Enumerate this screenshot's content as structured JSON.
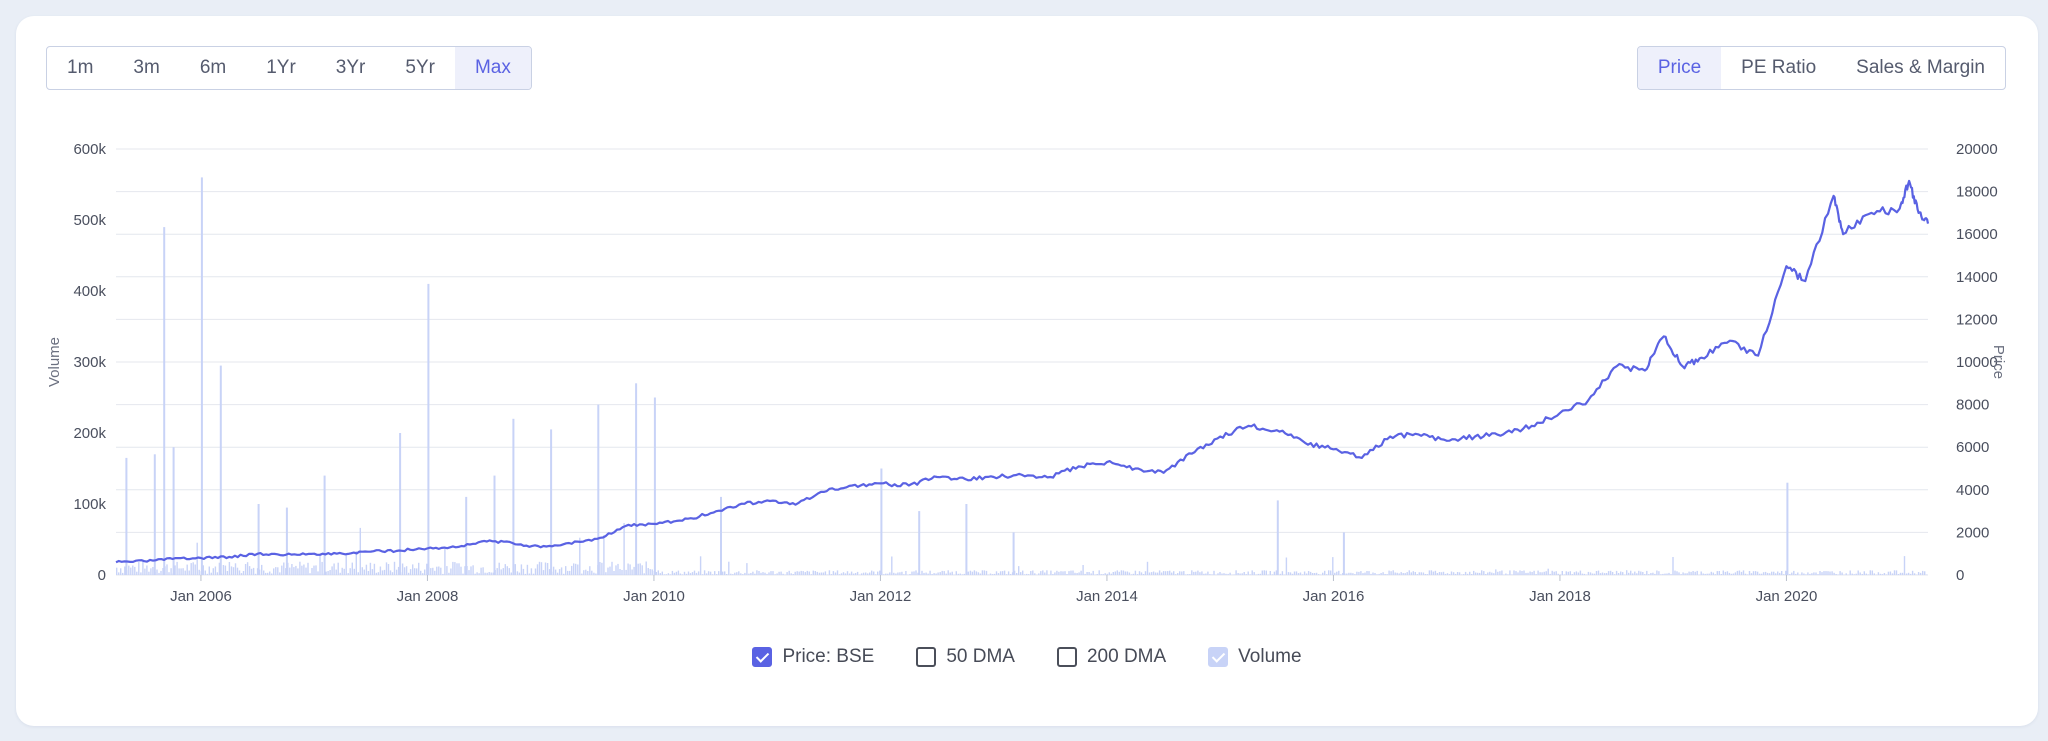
{
  "range_buttons": [
    {
      "label": "1m",
      "active": false
    },
    {
      "label": "3m",
      "active": false
    },
    {
      "label": "6m",
      "active": false
    },
    {
      "label": "1Yr",
      "active": false
    },
    {
      "label": "3Yr",
      "active": false
    },
    {
      "label": "5Yr",
      "active": false
    },
    {
      "label": "Max",
      "active": true
    }
  ],
  "metric_buttons": [
    {
      "label": "Price",
      "active": true
    },
    {
      "label": "PE Ratio",
      "active": false
    },
    {
      "label": "Sales & Margin",
      "active": false
    }
  ],
  "legend": [
    {
      "label": "Price: BSE",
      "checked": true,
      "style": "checked"
    },
    {
      "label": "50 DMA",
      "checked": false,
      "style": "unchecked"
    },
    {
      "label": "200 DMA",
      "checked": false,
      "style": "unchecked"
    },
    {
      "label": "Volume",
      "checked": true,
      "style": "light"
    }
  ],
  "colors": {
    "price_line": "#5a62e3",
    "volume_bars": "#c8d3f7",
    "active_accent": "#5a62e3",
    "grid": "#e4e7ee"
  },
  "chart_data": {
    "type": "line",
    "x_range": [
      "2005-04",
      "2021-04"
    ],
    "x_ticks": [
      "Jan 2006",
      "Jan 2008",
      "Jan 2010",
      "Jan 2012",
      "Jan 2014",
      "Jan 2016",
      "Jan 2018",
      "Jan 2020"
    ],
    "y_left": {
      "label": "Volume",
      "min": 0,
      "max": 600000,
      "ticks": [
        "0",
        "100k",
        "200k",
        "300k",
        "400k",
        "500k",
        "600k"
      ]
    },
    "y_right": {
      "label": "Price",
      "min": 0,
      "max": 20000,
      "ticks": [
        "0",
        "2000",
        "4000",
        "6000",
        "8000",
        "10000",
        "12000",
        "14000",
        "16000",
        "18000",
        "20000"
      ]
    },
    "grid": true,
    "series": [
      {
        "name": "Price: BSE",
        "axis": "right",
        "points": [
          [
            "2005-04",
            600
          ],
          [
            "2005-07",
            650
          ],
          [
            "2005-10",
            750
          ],
          [
            "2006-01",
            800
          ],
          [
            "2006-04",
            850
          ],
          [
            "2006-07",
            1000
          ],
          [
            "2006-10",
            950
          ],
          [
            "2007-01",
            1000
          ],
          [
            "2007-04",
            1000
          ],
          [
            "2007-07",
            1100
          ],
          [
            "2007-10",
            1150
          ],
          [
            "2008-01",
            1250
          ],
          [
            "2008-04",
            1300
          ],
          [
            "2008-07",
            1600
          ],
          [
            "2008-10",
            1500
          ],
          [
            "2009-01",
            1300
          ],
          [
            "2009-04",
            1500
          ],
          [
            "2009-07",
            1700
          ],
          [
            "2009-10",
            2300
          ],
          [
            "2010-01",
            2400
          ],
          [
            "2010-04",
            2550
          ],
          [
            "2010-07",
            2900
          ],
          [
            "2010-10",
            3300
          ],
          [
            "2011-01",
            3500
          ],
          [
            "2011-04",
            3300
          ],
          [
            "2011-07",
            3900
          ],
          [
            "2011-10",
            4200
          ],
          [
            "2012-01",
            4300
          ],
          [
            "2012-04",
            4200
          ],
          [
            "2012-07",
            4600
          ],
          [
            "2012-10",
            4500
          ],
          [
            "2013-01",
            4600
          ],
          [
            "2013-04",
            4700
          ],
          [
            "2013-07",
            4600
          ],
          [
            "2013-10",
            5100
          ],
          [
            "2014-01",
            5300
          ],
          [
            "2014-04",
            5000
          ],
          [
            "2014-07",
            4800
          ],
          [
            "2014-10",
            5700
          ],
          [
            "2015-01",
            6500
          ],
          [
            "2015-04",
            7000
          ],
          [
            "2015-07",
            6800
          ],
          [
            "2015-10",
            6200
          ],
          [
            "2016-01",
            5900
          ],
          [
            "2016-04",
            5500
          ],
          [
            "2016-07",
            6500
          ],
          [
            "2016-10",
            6600
          ],
          [
            "2017-01",
            6300
          ],
          [
            "2017-04",
            6500
          ],
          [
            "2017-07",
            6600
          ],
          [
            "2017-10",
            7000
          ],
          [
            "2018-01",
            7600
          ],
          [
            "2018-04",
            8200
          ],
          [
            "2018-07",
            9800
          ],
          [
            "2018-10",
            9600
          ],
          [
            "2018-12",
            11200
          ],
          [
            "2019-02",
            9800
          ],
          [
            "2019-04",
            10200
          ],
          [
            "2019-07",
            11000
          ],
          [
            "2019-10",
            10300
          ],
          [
            "2020-01",
            14500
          ],
          [
            "2020-03",
            13800
          ],
          [
            "2020-06",
            17800
          ],
          [
            "2020-07",
            16000
          ],
          [
            "2020-10",
            17000
          ],
          [
            "2021-01",
            17200
          ],
          [
            "2021-02",
            18500
          ],
          [
            "2021-03",
            17000
          ],
          [
            "2021-04",
            16500
          ]
        ]
      },
      {
        "name": "Volume",
        "axis": "left",
        "type": "bar",
        "spikes": [
          [
            "2005-05",
            165000
          ],
          [
            "2005-08",
            170000
          ],
          [
            "2005-09",
            490000
          ],
          [
            "2005-10",
            180000
          ],
          [
            "2006-01",
            560000
          ],
          [
            "2006-03",
            295000
          ],
          [
            "2006-07",
            100000
          ],
          [
            "2006-10",
            95000
          ],
          [
            "2007-02",
            140000
          ],
          [
            "2007-10",
            200000
          ],
          [
            "2008-01",
            410000
          ],
          [
            "2008-05",
            110000
          ],
          [
            "2008-08",
            140000
          ],
          [
            "2008-10",
            220000
          ],
          [
            "2009-02",
            205000
          ],
          [
            "2009-07",
            240000
          ],
          [
            "2009-11",
            270000
          ],
          [
            "2010-01",
            250000
          ],
          [
            "2010-08",
            110000
          ],
          [
            "2012-01",
            150000
          ],
          [
            "2012-05",
            90000
          ],
          [
            "2012-10",
            100000
          ],
          [
            "2013-03",
            60000
          ],
          [
            "2015-07",
            105000
          ],
          [
            "2016-02",
            60000
          ],
          [
            "2020-01",
            130000
          ]
        ],
        "baseline_level": 8000
      }
    ]
  }
}
